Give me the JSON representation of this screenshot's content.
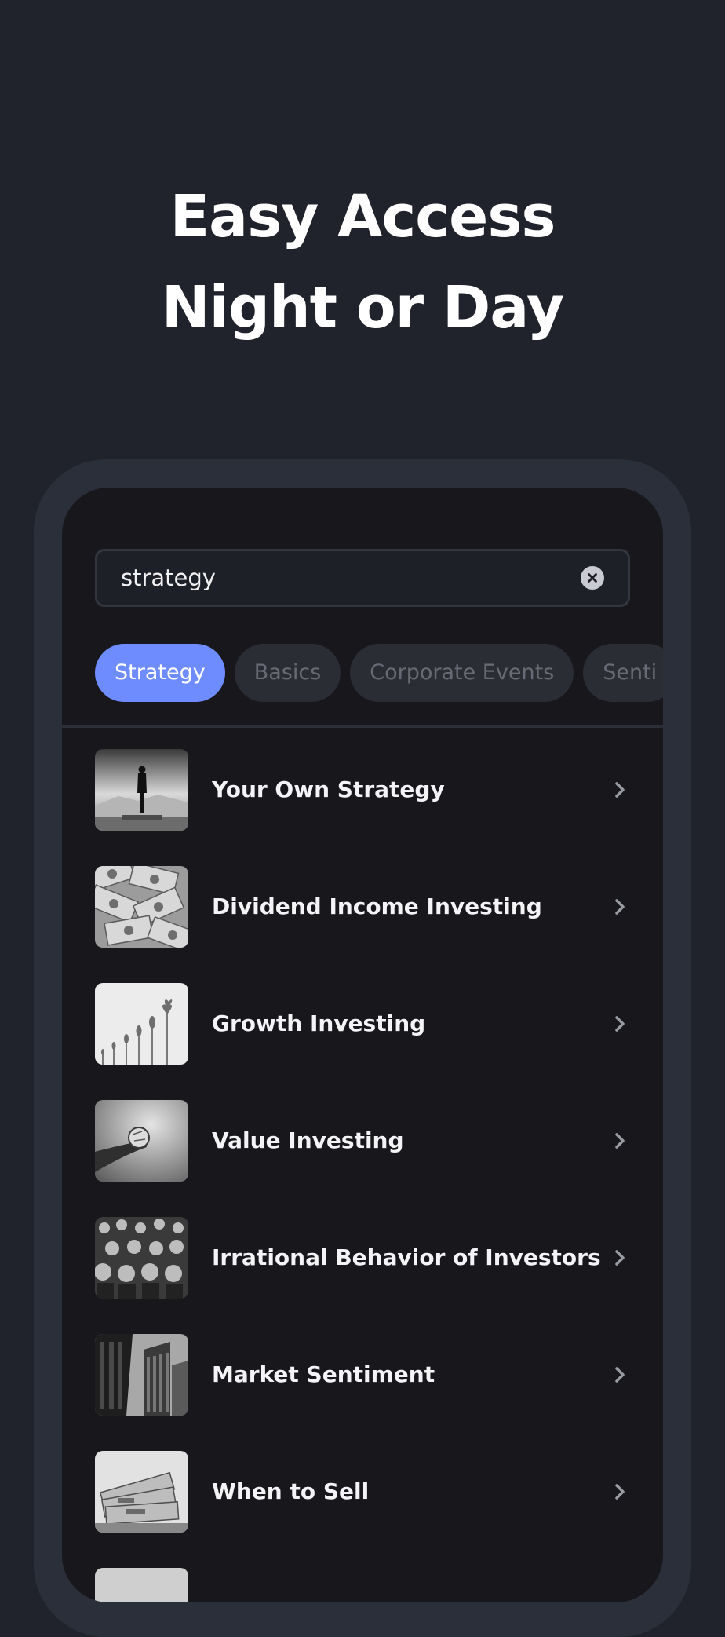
{
  "headline": {
    "line1": "Easy Access",
    "line2": "Night or Day"
  },
  "search": {
    "value": "strategy",
    "clear_icon": "close-circle-icon"
  },
  "chips": [
    {
      "label": "Strategy",
      "active": true
    },
    {
      "label": "Basics",
      "active": false
    },
    {
      "label": "Corporate Events",
      "active": false
    },
    {
      "label": "Senti",
      "active": false
    }
  ],
  "list": {
    "items": [
      {
        "label": "Your Own Strategy",
        "thumb": "person-standing-photo"
      },
      {
        "label": "Dividend Income Investing",
        "thumb": "dollar-bills-photo"
      },
      {
        "label": "Growth Investing",
        "thumb": "growing-plants-photo"
      },
      {
        "label": "Value Investing",
        "thumb": "hand-holding-globe-photo"
      },
      {
        "label": "Irrational Behavior of Investors",
        "thumb": "crowd-photo"
      },
      {
        "label": "Market Sentiment",
        "thumb": "stock-exchange-building-photo"
      },
      {
        "label": "When to Sell",
        "thumb": "cash-stack-photo"
      }
    ],
    "chevron_icon": "chevron-right-icon"
  },
  "colors": {
    "background": "#20232b",
    "phone_frame": "#2b2f3a",
    "screen": "#18181c",
    "accent": "#6f8cff",
    "chip_inactive": "#2b2d34"
  }
}
